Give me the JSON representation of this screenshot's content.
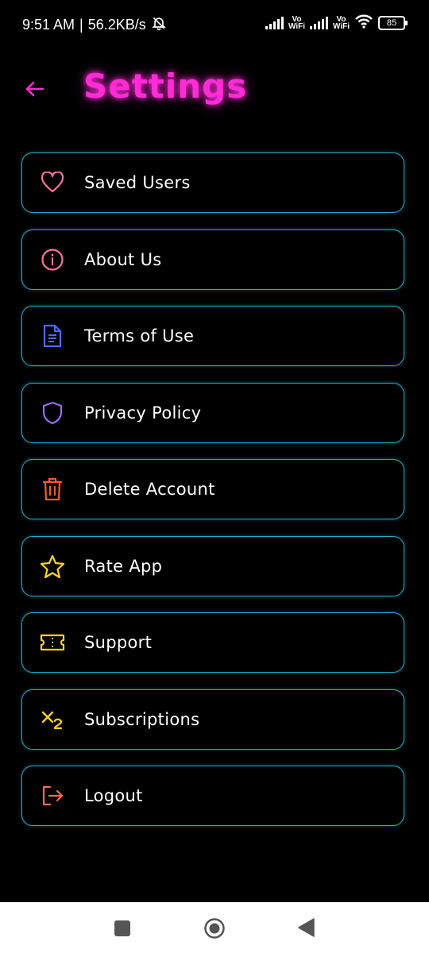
{
  "status_bar": {
    "time": "9:51 AM",
    "separator": "|",
    "speed": "56.2KB/s",
    "vowifi_1_top": "Vo",
    "vowifi_1_bottom": "WiFi",
    "vowifi_2_top": "Vo",
    "vowifi_2_bottom": "WiFi",
    "battery": "85"
  },
  "header": {
    "title": "Settings",
    "title_color": "#ff2bd6",
    "back_icon": "arrow-left-icon"
  },
  "menu": {
    "border_color": "#2aa8c8",
    "items": [
      {
        "label": "Saved Users",
        "icon": "heart-icon",
        "icon_color": "#ff6fa6"
      },
      {
        "label": "About Us",
        "icon": "info-icon",
        "icon_color": "#ff6fa6"
      },
      {
        "label": "Terms of Use",
        "icon": "document-icon",
        "icon_color": "#4a6cf0"
      },
      {
        "label": "Privacy Policy",
        "icon": "shield-icon",
        "icon_color": "#9a6cf0"
      },
      {
        "label": "Delete Account",
        "icon": "trash-icon",
        "icon_color": "#ff5a1f"
      },
      {
        "label": "Rate App",
        "icon": "star-icon",
        "icon_color": "#ffd21f"
      },
      {
        "label": "Support",
        "icon": "ticket-icon",
        "icon_color": "#ffd21f"
      },
      {
        "label": "Subscriptions",
        "icon": "subscript-icon",
        "icon_color": "#ffd21f"
      },
      {
        "label": "Logout",
        "icon": "logout-icon",
        "icon_color": "#ff6a5a"
      }
    ]
  },
  "nav_bar": {
    "recent_icon": "square-icon",
    "home_icon": "circle-icon",
    "back_icon": "triangle-back-icon"
  }
}
